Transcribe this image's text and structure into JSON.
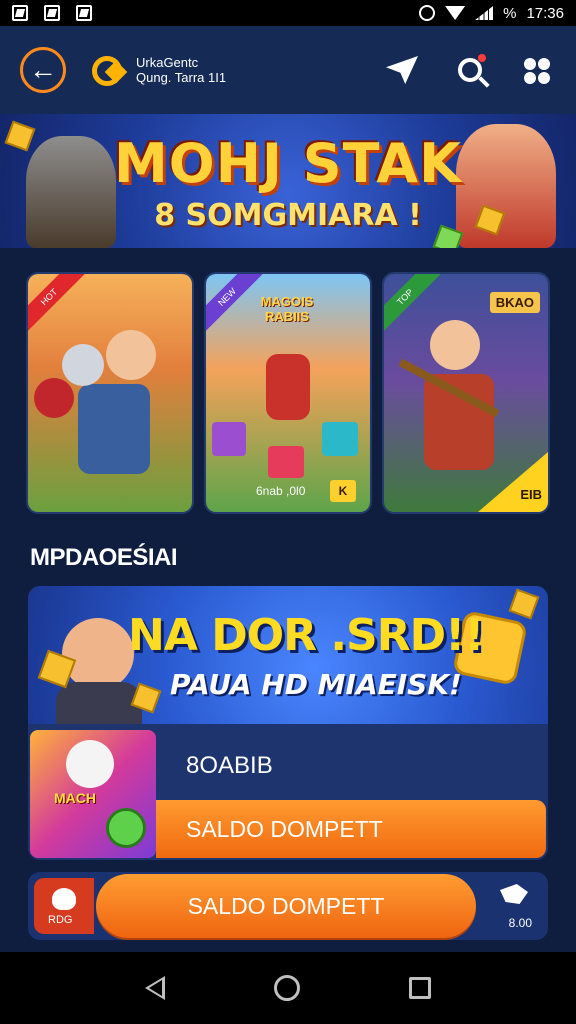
{
  "status_bar": {
    "time": "17:36",
    "battery_text": "%",
    "icons": [
      "notification-icon",
      "sim-icon",
      "gallery-icon",
      "alarm-icon",
      "wifi-icon",
      "signal-icon"
    ]
  },
  "header": {
    "back_icon": "arrow-left-icon",
    "brand_line1": "UrkaGentc",
    "brand_line2": "Qung. Tarra 1I1",
    "icons": [
      "send-icon",
      "search-icon",
      "users-icon"
    ]
  },
  "banner": {
    "title": "MOHJ STAK",
    "subtitle": "8 SOMGMIARA !"
  },
  "cards": [
    {
      "ribbon": "HOT",
      "caption": "",
      "tag": ""
    },
    {
      "ribbon": "NEW",
      "tag": "MAGOIS RABIIS",
      "caption": "6nab ,0l0",
      "badge": "K"
    },
    {
      "ribbon": "TOP",
      "tag": "BKAO",
      "corner": "EIB"
    }
  ],
  "section": {
    "title": "MPDAOEŚIAI"
  },
  "promo": {
    "title": "NA DOR .SRD!!",
    "subtitle": "PAUA HD MIAEISK!",
    "code_label": "8OABIB",
    "wallet_label": "SALDO DOMPETT",
    "thumb_label": "MACH"
  },
  "action_bar": {
    "left_label": "RDG",
    "button_label": "SALDO DOMPETT",
    "right_label": "8.00"
  },
  "colors": {
    "background": "#0f1d3e",
    "header": "#152a55",
    "accent_orange": "#f06a10",
    "title_yellow": "#ffd23a"
  }
}
